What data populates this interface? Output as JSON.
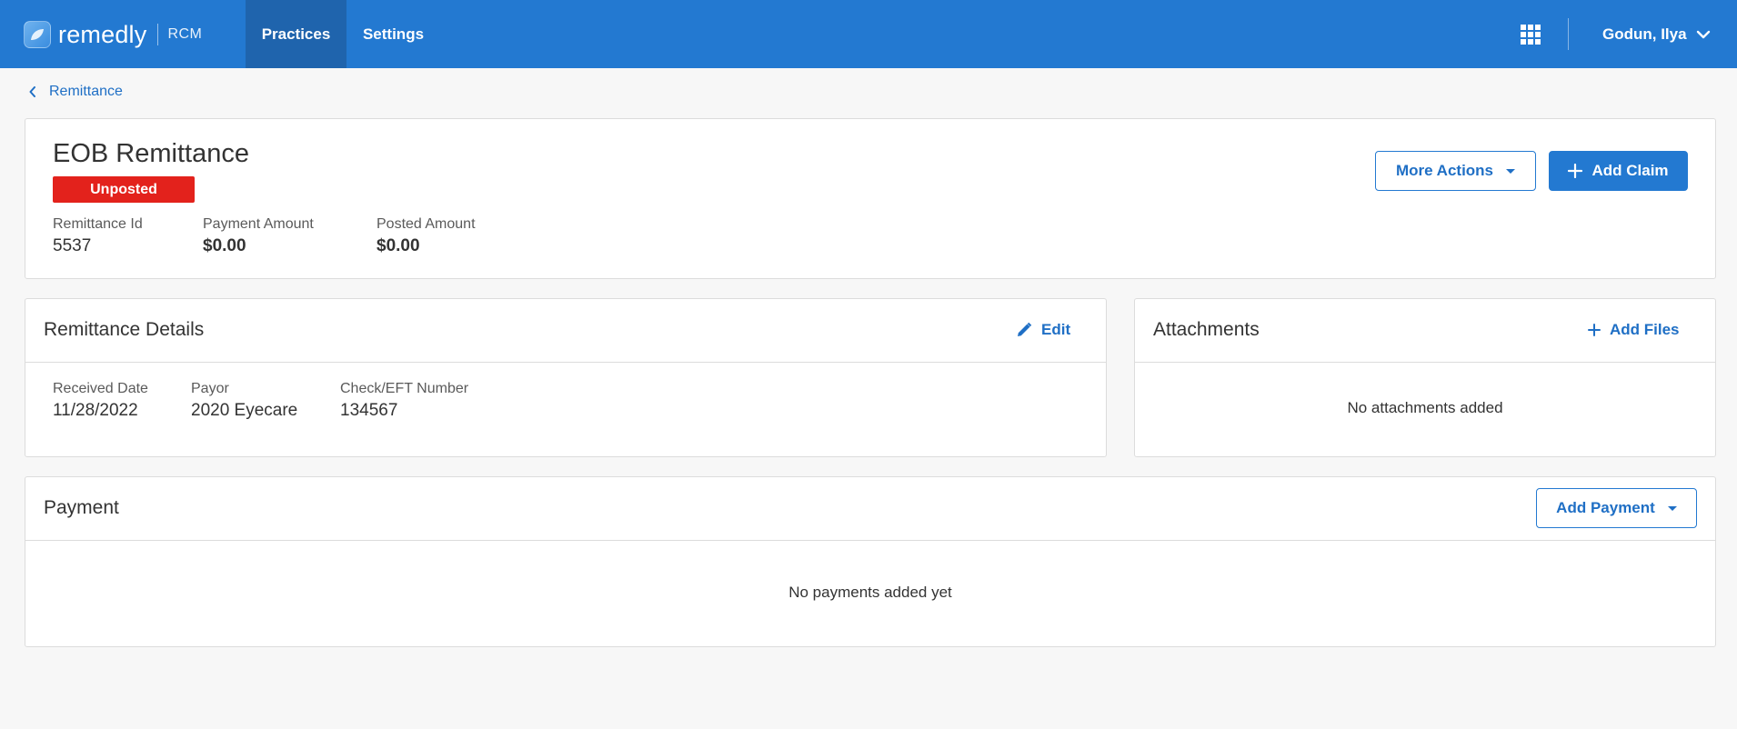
{
  "topbar": {
    "brand": "remedly",
    "brand_sub": "RCM",
    "nav": [
      {
        "label": "Practices",
        "active": true
      },
      {
        "label": "Settings",
        "active": false
      }
    ],
    "apps_icon": "grid-icon",
    "user_name": "Godun, Ilya",
    "colors": {
      "bar": "#2379d1",
      "active_tab": "#1f64ad"
    }
  },
  "breadcrumb": {
    "label": "Remittance"
  },
  "header": {
    "title": "EOB Remittance",
    "status": "Unposted",
    "status_color": "#e3221c",
    "fields": [
      {
        "label": "Remittance Id",
        "value": "5537"
      },
      {
        "label": "Payment Amount",
        "value": "$0.00"
      },
      {
        "label": "Posted Amount",
        "value": "$0.00"
      }
    ],
    "more_actions_label": "More Actions",
    "add_claim_label": "Add Claim"
  },
  "details": {
    "title": "Remittance Details",
    "edit_label": "Edit",
    "fields": [
      {
        "label": "Received Date",
        "value": "11/28/2022"
      },
      {
        "label": "Payor",
        "value": "2020 Eyecare"
      },
      {
        "label": "Check/EFT Number",
        "value": "134567"
      }
    ]
  },
  "attachments": {
    "title": "Attachments",
    "add_label": "Add Files",
    "empty": "No attachments added"
  },
  "payment": {
    "title": "Payment",
    "add_label": "Add Payment",
    "empty": "No payments added yet"
  }
}
